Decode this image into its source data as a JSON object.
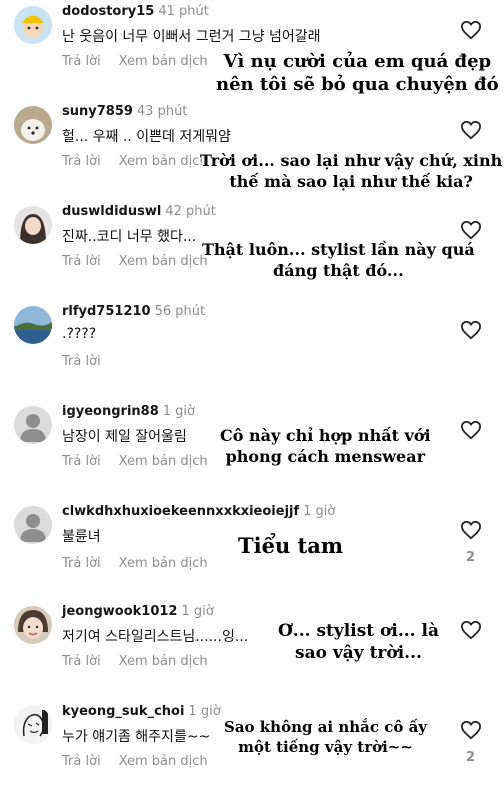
{
  "comments": [
    {
      "username": "dodostory15",
      "time": "41 phút",
      "text": "난 웃음이 너무 이뻐서 그런거 그냥 넘어갈래",
      "reply": "Trả lời",
      "translate": "Xem bản dịch",
      "likes": "",
      "avatar": "cartoon-boy-yellow-hat",
      "overlay": "Vì nụ cười của em quá đẹp\nnên tôi sẽ bỏ qua chuyện đó"
    },
    {
      "username": "suny7859",
      "time": "43 phút",
      "text": "헐... 우째 .. 이쁜데 저게뭐얌",
      "reply": "Trả lời",
      "translate": "Xem bản dịch",
      "likes": "",
      "avatar": "white-dog",
      "overlay": "Trời ơi... sao lại như vậy chứ, xinh\nthế mà sao lại như thế kia?"
    },
    {
      "username": "duswldiduswl",
      "time": "42 phút",
      "text": "진짜..코디 너무 했다...",
      "reply": "Trả lời",
      "translate": "Xem bản dịch",
      "likes": "",
      "avatar": "girl-photo",
      "overlay": "Thật luôn... stylist lần này quá\nđáng thật đó..."
    },
    {
      "username": "rlfyd751210",
      "time": "56 phút",
      "text": ".????",
      "reply": "Trả lời",
      "translate": "",
      "likes": "",
      "avatar": "sea-landscape",
      "overlay": ""
    },
    {
      "username": "igyeongrin88",
      "time": "1 giờ",
      "text": "남장이 제일 잘어울림",
      "reply": "Trả lời",
      "translate": "Xem bản dịch",
      "likes": "",
      "avatar": "default",
      "overlay": "Cô này chỉ hợp nhất với\nphong cách menswear"
    },
    {
      "username": "clwkdhxhuxioekeennxxkxieoiejjf",
      "time": "1 giờ",
      "text": "불륜녀",
      "reply": "Trả lời",
      "translate": "Xem bản dịch",
      "likes": "2",
      "avatar": "default",
      "overlay": "Tiểu tam"
    },
    {
      "username": "jeongwook1012",
      "time": "1 giờ",
      "text": "저기여 스타일리스트님......잉...",
      "reply": "Trả lời",
      "translate": "Xem bản dịch",
      "likes": "",
      "avatar": "face-photo",
      "overlay": "Ơ... stylist ơi... là\nsao vậy trời..."
    },
    {
      "username": "kyeong_suk_choi",
      "time": "1 giờ",
      "text": "누가 얘기좀 해주지를~~",
      "reply": "Trả lời",
      "translate": "Xem bản dịch",
      "likes": "2",
      "avatar": "sketch-logo",
      "overlay": "Sao không ai nhắc cô ấy\nmột tiếng vậy trời~~"
    }
  ]
}
